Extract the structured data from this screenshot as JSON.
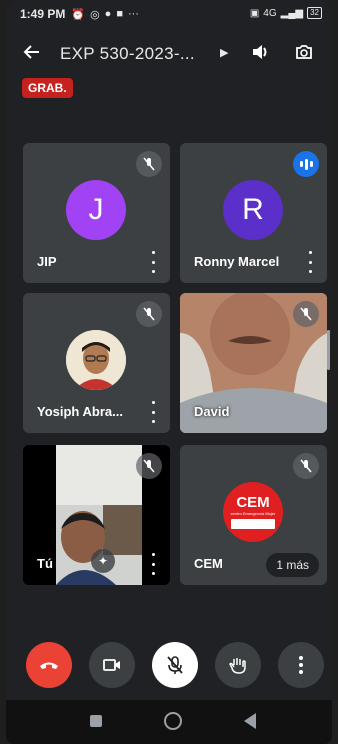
{
  "status_bar": {
    "time": "1:49 PM",
    "network": "4G",
    "battery": "32"
  },
  "header": {
    "title": "EXP 530-2023-...",
    "recording_badge": "GRAB."
  },
  "participants": [
    {
      "name": "JIP",
      "initial": "J",
      "avatar_color": "#a142f4",
      "mic": "off"
    },
    {
      "name": "Ronny Marcel",
      "initial": "R",
      "avatar_color": "#5b2fc9",
      "mic": "speaking"
    },
    {
      "name": "Yosiph Abra...",
      "mic": "off"
    },
    {
      "name": "David",
      "mic": "off"
    },
    {
      "name": "Tú",
      "mic": "off"
    },
    {
      "name": "CEM",
      "mic": "off",
      "logo_text": "CEM",
      "logo_subtext": "centro Emergencia Mujer"
    }
  ],
  "more_participants_label": "1 más",
  "colors": {
    "end_call": "#ea4335",
    "accent": "#1a73e8",
    "tile_bg": "#3c4043"
  }
}
